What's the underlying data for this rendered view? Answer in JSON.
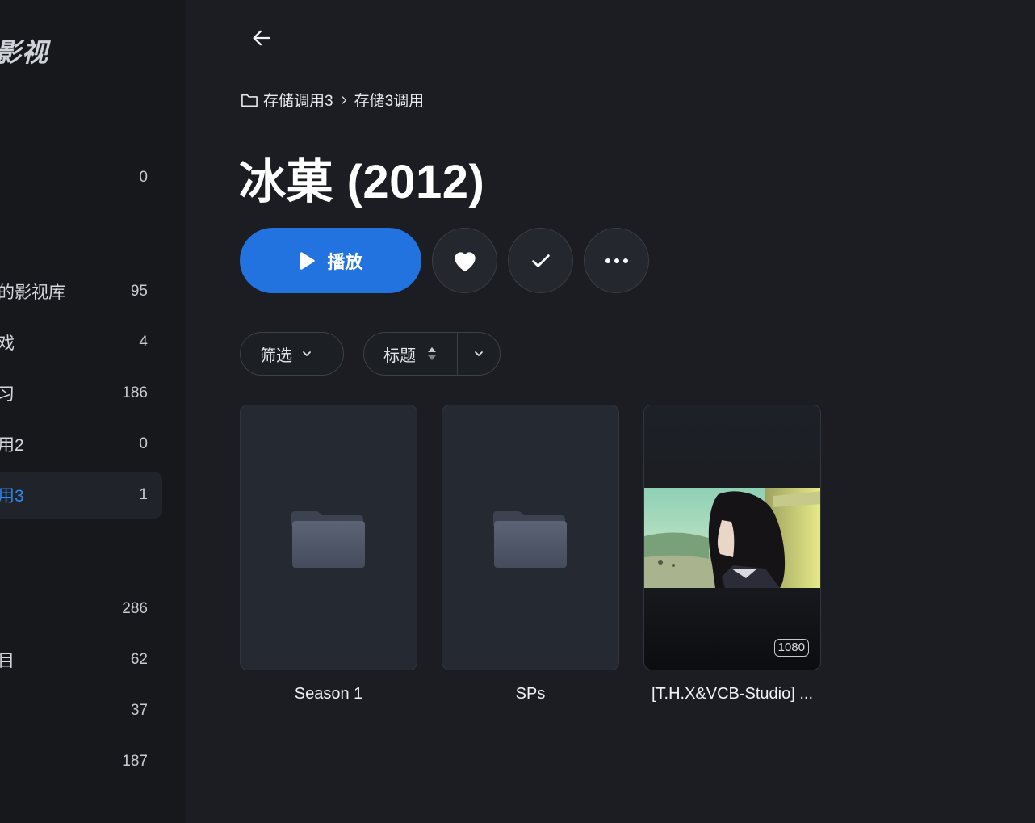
{
  "sidebar": {
    "brand": "影视",
    "items": [
      {
        "label": "",
        "count": "0"
      },
      {
        "label": "的影视库",
        "count": "95"
      },
      {
        "label": "戏",
        "count": "4"
      },
      {
        "label": "习",
        "count": "186"
      },
      {
        "label": "用2",
        "count": "0"
      },
      {
        "label": "用3",
        "count": "1",
        "active": true
      },
      {
        "label": "",
        "count": "286"
      },
      {
        "label": "目",
        "count": "62"
      },
      {
        "label": "",
        "count": "37"
      },
      {
        "label": "",
        "count": "187"
      }
    ]
  },
  "breadcrumb": {
    "icon": "folder-icon",
    "items": [
      "存储调用3",
      "存储3调用"
    ]
  },
  "title": "冰菓 (2012)",
  "actions": {
    "play_label": "播放",
    "favorite_icon": "heart-icon",
    "watched_icon": "check-icon",
    "more_icon": "more-icon"
  },
  "filters": {
    "filter_label": "筛选",
    "sort_label": "标题"
  },
  "items": [
    {
      "title": "Season 1",
      "type": "folder"
    },
    {
      "title": "SPs",
      "type": "folder"
    },
    {
      "title": "[T.H.X&VCB-Studio] ...",
      "type": "video",
      "badge": "1080"
    }
  ],
  "colors": {
    "accent": "#2273e0",
    "background": "#1b1d22",
    "sidebar": "#16181c"
  }
}
